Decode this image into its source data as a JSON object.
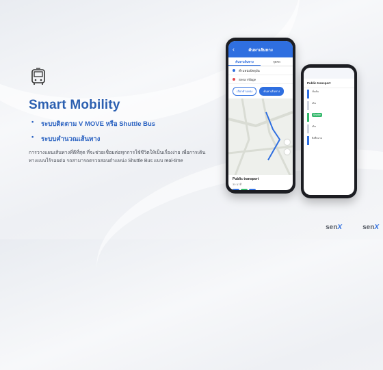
{
  "slide": {
    "title": "Smart Mobility",
    "bullets": [
      "ระบบติดตาม V MOVE หรือ Shuttle Bus",
      "ระบบคำนวณเส้นทาง"
    ],
    "description": "การวางแผนเส้นทางที่ดีที่สุด ที่จะช่วยเชื่อมต่อทุกการใช้ชีวิตให้เป็นเรื่องง่าย เพื่อการเดินทางแบบไร้รอยต่อ รถสามารถตรวจสอบตำแหน่ง Shuttle Bus แบบ real-time",
    "icon": "bus-icon",
    "accent": "#2b5fb0"
  },
  "phone_main": {
    "header_title": "ค้นหาเส้นทาง",
    "tabs": [
      "ค้นหาเส้นทาง",
      "จุดรถ"
    ],
    "origin": "ตำแหน่งปัจจุบัน",
    "destination": "Sena Village",
    "buttons": [
      "เลือกตำแหน่ง",
      "ค้นหาเส้นทาง"
    ],
    "card_title": "Public transport",
    "card_sub": "30 นาที"
  },
  "phone_second": {
    "card_title": "Public transport",
    "steps": [
      "เริ่มต้น",
      "เดิน",
      "Shuttle",
      "เดิน",
      "ถึงที่หมาย"
    ]
  },
  "logos": [
    "sen",
    "sen"
  ]
}
